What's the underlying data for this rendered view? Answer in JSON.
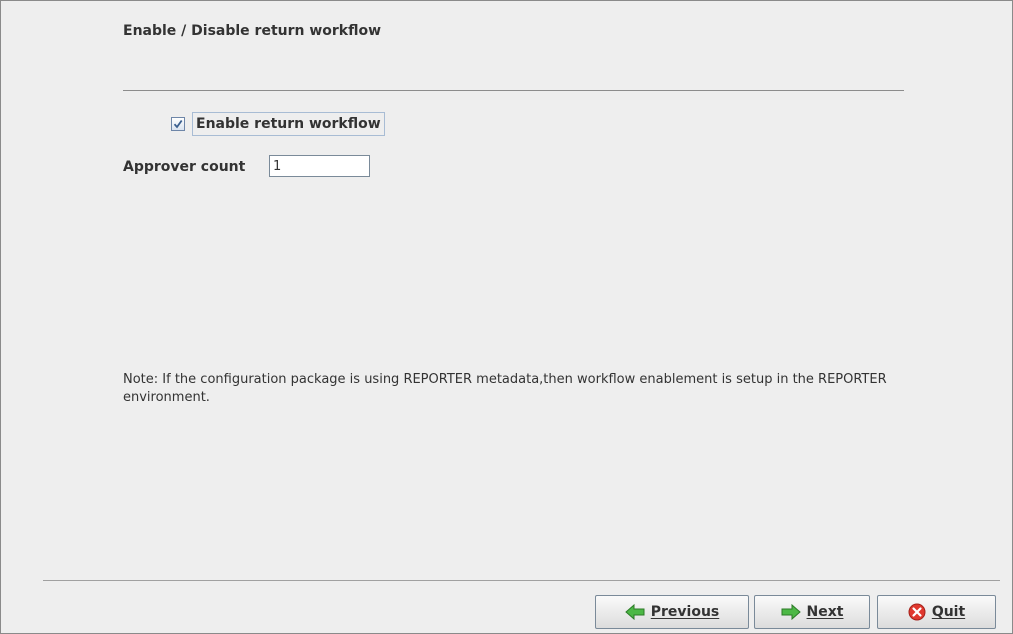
{
  "page": {
    "title": "Enable / Disable return workflow"
  },
  "workflow": {
    "enable_label": "Enable return workflow",
    "enabled": true
  },
  "approver": {
    "label": "Approver count",
    "value": "1"
  },
  "note": {
    "text": "Note: If the configuration package is using REPORTER metadata,then workflow enablement is setup in the REPORTER environment."
  },
  "buttons": {
    "previous": {
      "label": "Previous",
      "icon": "arrow-left-icon",
      "color": "#3aa335"
    },
    "next": {
      "label": "Next",
      "icon": "arrow-right-icon",
      "color": "#3aa335"
    },
    "quit": {
      "label": "Quit",
      "icon": "close-circle-icon",
      "color": "#d9342b"
    }
  }
}
